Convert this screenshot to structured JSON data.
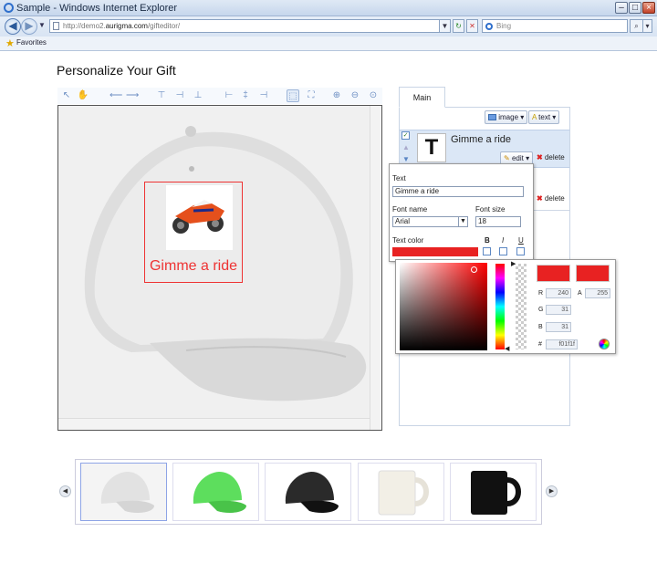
{
  "window": {
    "title": "Sample - Windows Internet Explorer"
  },
  "browser": {
    "address_prefix": "http://demo2.",
    "address_host": "aurigma.com",
    "address_suffix": "/gifteditor/",
    "search_placeholder": "Bing",
    "favorites_label": "Favorites"
  },
  "page": {
    "title": "Personalize Your Gift"
  },
  "editor": {
    "canvas_text": "Gimme a ride",
    "tabs": [
      "Main"
    ],
    "add_image_label": "image",
    "add_text_label": "text",
    "layers": [
      {
        "name": "Gimme a ride",
        "icon_glyph": "T",
        "edit_label": "edit",
        "delete_label": "delete"
      },
      {
        "delete_label": "delete"
      }
    ]
  },
  "text_popup": {
    "text_label": "Text",
    "text_value": "Gimme a ride",
    "font_name_label": "Font name",
    "font_name_value": "Arial",
    "font_size_label": "Font size",
    "font_size_value": "18",
    "text_color_label": "Text color",
    "bold_label": "B",
    "italic_label": "I",
    "underline_label": "U",
    "color": "#e82222"
  },
  "color_picker": {
    "r_label": "R",
    "r_value": "240",
    "a_label": "A",
    "a_value": "255",
    "g_label": "G",
    "g_value": "31",
    "b_label": "B",
    "b_value": "31",
    "hex_label": "#",
    "hex_value": "f01f1f"
  },
  "products": [
    {
      "name": "white-cap",
      "color": "#e8e8e8",
      "selected": true
    },
    {
      "name": "green-cap",
      "color": "#5dde5d",
      "selected": false
    },
    {
      "name": "black-cap",
      "color": "#222222",
      "selected": false
    },
    {
      "name": "white-mug",
      "color": "#f2efe6",
      "selected": false
    },
    {
      "name": "black-mug",
      "color": "#111111",
      "selected": false
    }
  ]
}
